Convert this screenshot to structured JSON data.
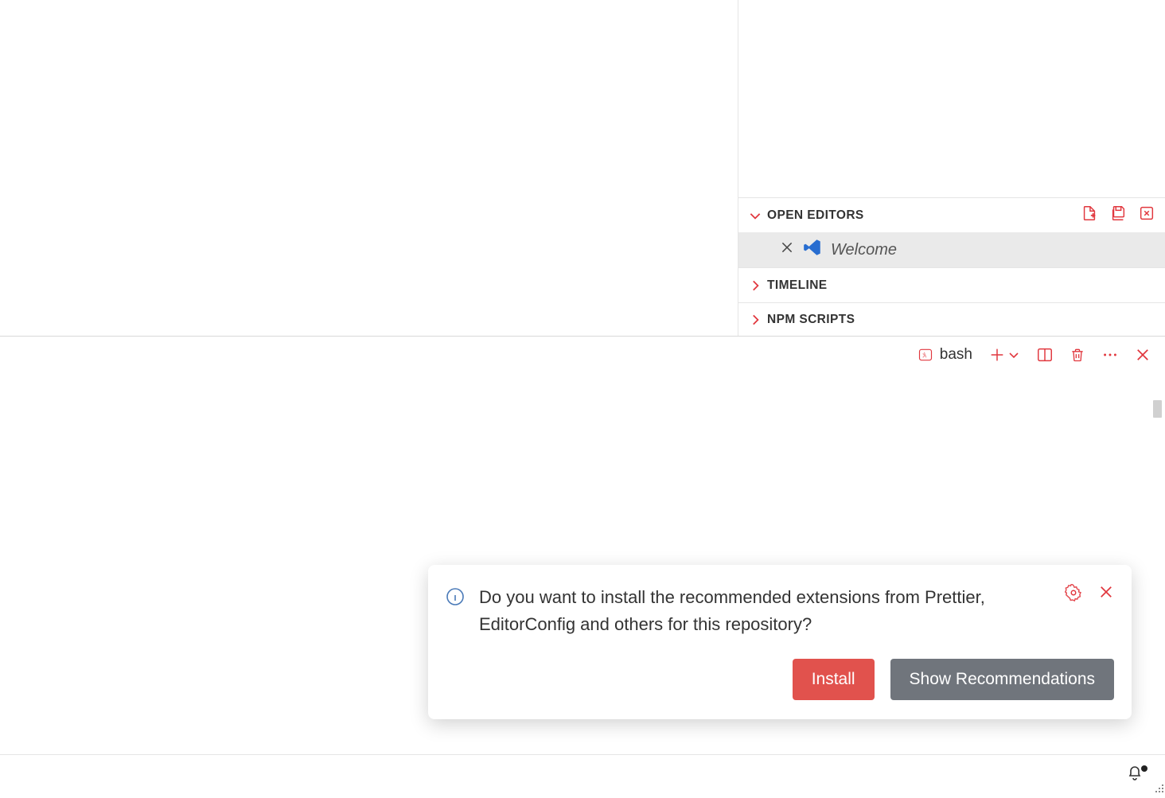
{
  "sidebar": {
    "sections": {
      "open_editors": {
        "label": "OPEN EDITORS",
        "expanded": true,
        "items": [
          {
            "name": "Welcome"
          }
        ]
      },
      "timeline": {
        "label": "TIMELINE",
        "expanded": false
      },
      "npm_scripts": {
        "label": "NPM SCRIPTS",
        "expanded": false
      }
    }
  },
  "terminal": {
    "shell": "bash"
  },
  "notification": {
    "message": "Do you want to install the recommended extensions from Prettier, EditorConfig and others for this repository?",
    "primary": "Install",
    "secondary": "Show Recommendations"
  },
  "statusbar": {
    "has_notifications": true
  },
  "colors": {
    "accent": "#e1373e"
  }
}
